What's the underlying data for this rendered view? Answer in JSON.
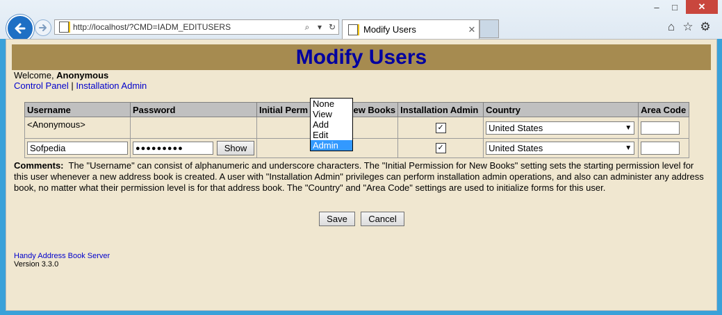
{
  "browser": {
    "address": "http://localhost/?CMD=IADM_EDITUSERS",
    "tab_title": "Modify Users",
    "window_minimize": "–",
    "window_maximize": "□",
    "window_close": "✕",
    "toolbar_icons": [
      "home-icon",
      "star-icon",
      "gear-icon"
    ]
  },
  "page": {
    "title": "Modify Users",
    "welcome_prefix": "Welcome, ",
    "welcome_user": "Anonymous",
    "links": {
      "control_panel": "Control Panel",
      "separator": " | ",
      "installation_admin": "Installation Admin"
    },
    "table": {
      "headers": {
        "username": "Username",
        "password": "Password",
        "initial_perm": "Initial Perm",
        "new_books": "New Books",
        "installation_admin": "Installation Admin",
        "country": "Country",
        "area_code": "Area Code"
      },
      "rows": [
        {
          "username": "<Anonymous>",
          "installation_admin_checked": "✓",
          "country": "United States",
          "area_code": ""
        },
        {
          "username": "Sofpedia",
          "password": "●●●●●●●●●",
          "show_button": "Show",
          "installation_admin_checked": "✓",
          "country": "United States",
          "area_code": ""
        }
      ]
    },
    "permission_dropdown": {
      "options": [
        "None",
        "View",
        "Add",
        "Edit",
        "Admin"
      ],
      "highlighted": "Admin"
    },
    "comments_label": "Comments:",
    "comments_text": "The \"Username\" can consist of alphanumeric and underscore characters. The \"Initial Permission for New Books\" setting sets the starting permission level for this user whenever a new address book is created.  A user with \"Installation Admin\" privileges can perform installation admin operations, and also can administer any address book, no matter what their permission level is for that address book.  The \"Country\" and \"Area Code\" settings are used to initialize forms for this user.",
    "buttons": {
      "save": "Save",
      "cancel": "Cancel"
    },
    "footer": {
      "product": "Handy Address Book Server",
      "version": "Version 3.3.0"
    },
    "colors": {
      "header_bg": "#a68b50",
      "title": "#0000a0",
      "page_bg": "#f0e7d0",
      "link": "#0000cc"
    }
  }
}
